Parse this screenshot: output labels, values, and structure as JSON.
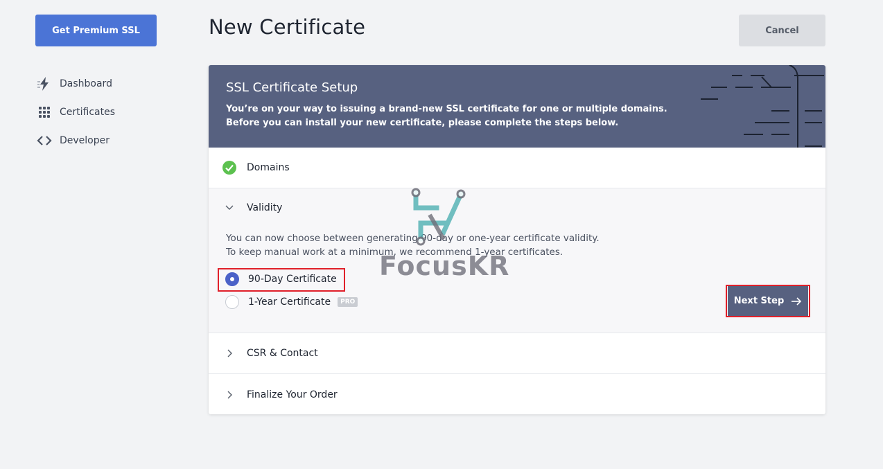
{
  "sidebar": {
    "premium_label": "Get Premium SSL",
    "items": [
      {
        "label": "Dashboard",
        "icon": "lightning-icon"
      },
      {
        "label": "Certificates",
        "icon": "grid-dots-icon"
      },
      {
        "label": "Developer",
        "icon": "code-brackets-icon"
      }
    ]
  },
  "header": {
    "title": "New Certificate",
    "cancel_label": "Cancel"
  },
  "banner": {
    "title": "SSL Certificate Setup",
    "line1": "You’re on your way to issuing a brand-new SSL certificate for one or multiple domains.",
    "line2": "Before you can install your new certificate, please complete the steps below."
  },
  "steps": {
    "domains": {
      "label": "Domains",
      "status": "complete",
      "icon": "check-circle-icon"
    },
    "validity": {
      "label": "Validity",
      "icon": "chevron-down-icon",
      "desc_line1": "You can now choose between generating 90-day or one-year certificate validity.",
      "desc_line2": "To keep manual work at a minimum, we recommend 1-year certificates.",
      "options": [
        {
          "label": "90-Day Certificate",
          "checked": true
        },
        {
          "label": "1-Year Certificate",
          "checked": false,
          "badge": "PRO"
        }
      ],
      "next_label": "Next Step"
    },
    "csr": {
      "label": "CSR & Contact",
      "icon": "chevron-right-icon"
    },
    "finalize": {
      "label": "Finalize Your Order",
      "icon": "chevron-right-icon"
    }
  },
  "watermark": {
    "text": "FocusKR"
  },
  "colors": {
    "accent": "#4b74d6",
    "banner": "#576180",
    "success": "#5cc14f",
    "highlight": "#e0202a"
  }
}
